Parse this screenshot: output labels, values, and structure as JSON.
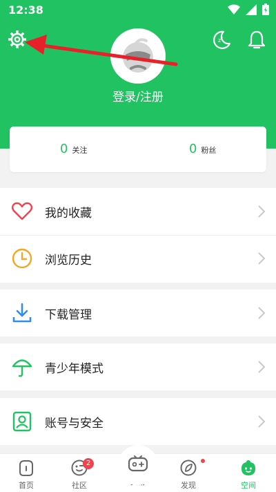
{
  "status_bar": {
    "time": "12:38"
  },
  "profile": {
    "login_label": "登录/注册"
  },
  "stats": {
    "following": {
      "count": "0",
      "label": "关注"
    },
    "fans": {
      "count": "0",
      "label": "粉丝"
    }
  },
  "menu": [
    {
      "label": "我的收藏",
      "icon": "heart-icon"
    },
    {
      "label": "浏览历史",
      "icon": "clock-icon"
    },
    {
      "label": "下载管理",
      "icon": "download-icon"
    },
    {
      "label": "青少年模式",
      "icon": "umbrella-icon"
    },
    {
      "label": "账号与安全",
      "icon": "account-icon"
    }
  ],
  "tabs": [
    {
      "label": "首页",
      "icon": "home-icon"
    },
    {
      "label": "社区",
      "icon": "community-icon",
      "badge": "2"
    },
    {
      "label": "爽游",
      "icon": "gamepad-icon"
    },
    {
      "label": "发现",
      "icon": "discover-icon"
    },
    {
      "label": "空间",
      "icon": "space-icon",
      "active": true
    }
  ],
  "colors": {
    "brand": "#21c261",
    "badge": "#f3424b",
    "arrow": "#e8202a"
  }
}
